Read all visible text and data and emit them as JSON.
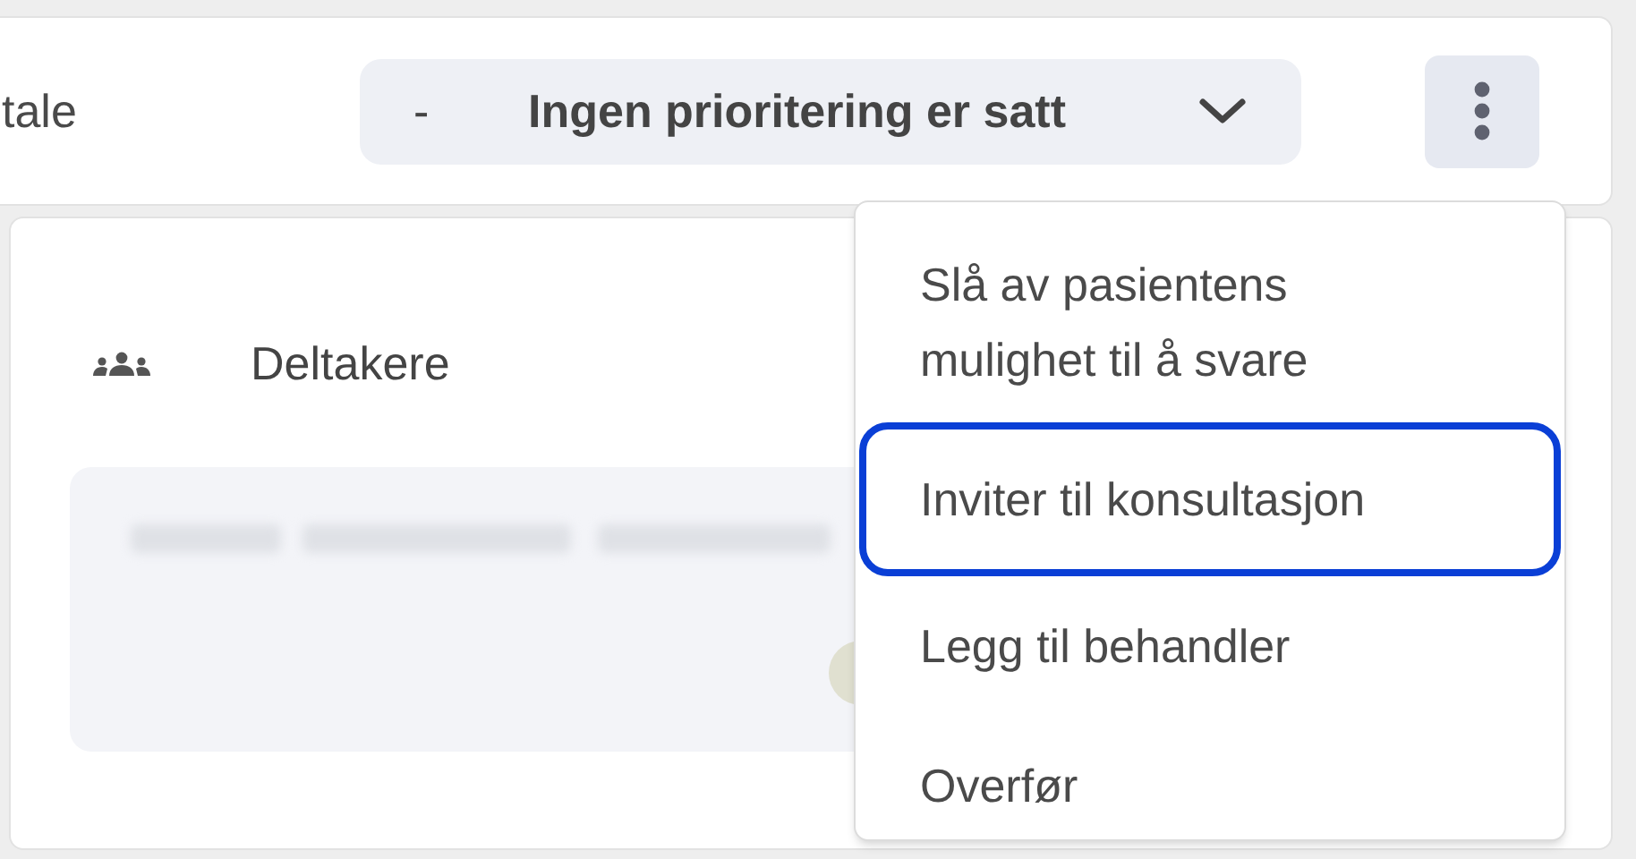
{
  "header": {
    "title_fragment": "tale",
    "priority": {
      "prefix": "-",
      "label": "Ingen prioritering er satt"
    }
  },
  "participants": {
    "title": "Deltakere"
  },
  "menu": {
    "expanded": true,
    "items": [
      {
        "label": "Slå av pasientens mulighet til å svare",
        "focused": false
      },
      {
        "label": "Inviter til konsultasjon",
        "focused": true
      },
      {
        "label": "Legg til behandler",
        "focused": false
      },
      {
        "label": "Overfør",
        "focused": false
      }
    ]
  }
}
